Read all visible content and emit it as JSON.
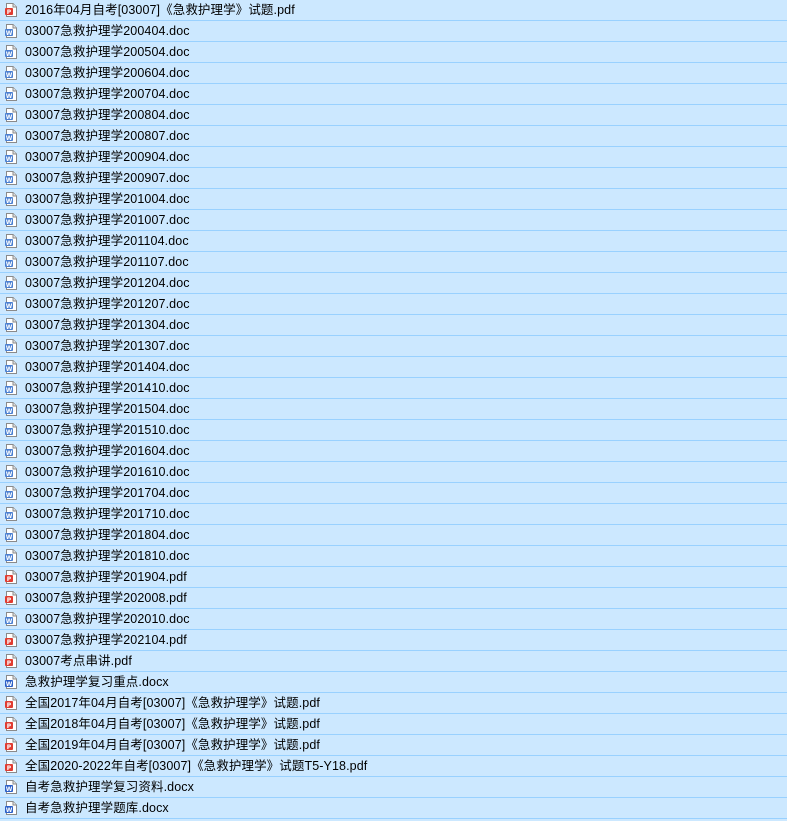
{
  "icons": {
    "pdf": {
      "name": "pdf-file-icon",
      "color": "#e03c31",
      "glyph": "P"
    },
    "doc": {
      "name": "doc-file-icon",
      "color": "#4a7fd1",
      "glyph": "W"
    },
    "docx": {
      "name": "docx-file-icon",
      "color": "#2b5fc7",
      "glyph": "W"
    }
  },
  "files": [
    {
      "name": "2016年04月自考[03007]《急救护理学》试题.pdf",
      "type": "pdf"
    },
    {
      "name": "03007急救护理学200404.doc",
      "type": "doc"
    },
    {
      "name": "03007急救护理学200504.doc",
      "type": "doc"
    },
    {
      "name": "03007急救护理学200604.doc",
      "type": "doc"
    },
    {
      "name": "03007急救护理学200704.doc",
      "type": "doc"
    },
    {
      "name": "03007急救护理学200804.doc",
      "type": "doc"
    },
    {
      "name": "03007急救护理学200807.doc",
      "type": "doc"
    },
    {
      "name": "03007急救护理学200904.doc",
      "type": "doc"
    },
    {
      "name": "03007急救护理学200907.doc",
      "type": "doc"
    },
    {
      "name": "03007急救护理学201004.doc",
      "type": "doc"
    },
    {
      "name": "03007急救护理学201007.doc",
      "type": "doc"
    },
    {
      "name": "03007急救护理学201104.doc",
      "type": "doc"
    },
    {
      "name": "03007急救护理学201107.doc",
      "type": "doc"
    },
    {
      "name": "03007急救护理学201204.doc",
      "type": "doc"
    },
    {
      "name": "03007急救护理学201207.doc",
      "type": "doc"
    },
    {
      "name": "03007急救护理学201304.doc",
      "type": "doc"
    },
    {
      "name": "03007急救护理学201307.doc",
      "type": "doc"
    },
    {
      "name": "03007急救护理学201404.doc",
      "type": "doc"
    },
    {
      "name": "03007急救护理学201410.doc",
      "type": "doc"
    },
    {
      "name": "03007急救护理学201504.doc",
      "type": "doc"
    },
    {
      "name": "03007急救护理学201510.doc",
      "type": "doc"
    },
    {
      "name": "03007急救护理学201604.doc",
      "type": "doc"
    },
    {
      "name": "03007急救护理学201610.doc",
      "type": "doc"
    },
    {
      "name": "03007急救护理学201704.doc",
      "type": "doc"
    },
    {
      "name": "03007急救护理学201710.doc",
      "type": "doc"
    },
    {
      "name": "03007急救护理学201804.doc",
      "type": "doc"
    },
    {
      "name": "03007急救护理学201810.doc",
      "type": "doc"
    },
    {
      "name": "03007急救护理学201904.pdf",
      "type": "pdf"
    },
    {
      "name": "03007急救护理学202008.pdf",
      "type": "pdf"
    },
    {
      "name": "03007急救护理学202010.doc",
      "type": "doc"
    },
    {
      "name": "03007急救护理学202104.pdf",
      "type": "pdf"
    },
    {
      "name": "03007考点串讲.pdf",
      "type": "pdf"
    },
    {
      "name": "急救护理学复习重点.docx",
      "type": "docx"
    },
    {
      "name": "全国2017年04月自考[03007]《急救护理学》试题.pdf",
      "type": "pdf"
    },
    {
      "name": "全国2018年04月自考[03007]《急救护理学》试题.pdf",
      "type": "pdf"
    },
    {
      "name": "全国2019年04月自考[03007]《急救护理学》试题.pdf",
      "type": "pdf"
    },
    {
      "name": "全国2020-2022年自考[03007]《急救护理学》试题T5-Y18.pdf",
      "type": "pdf"
    },
    {
      "name": "自考急救护理学复习资料.docx",
      "type": "docx"
    },
    {
      "name": "自考急救护理学题库.docx",
      "type": "docx"
    }
  ]
}
